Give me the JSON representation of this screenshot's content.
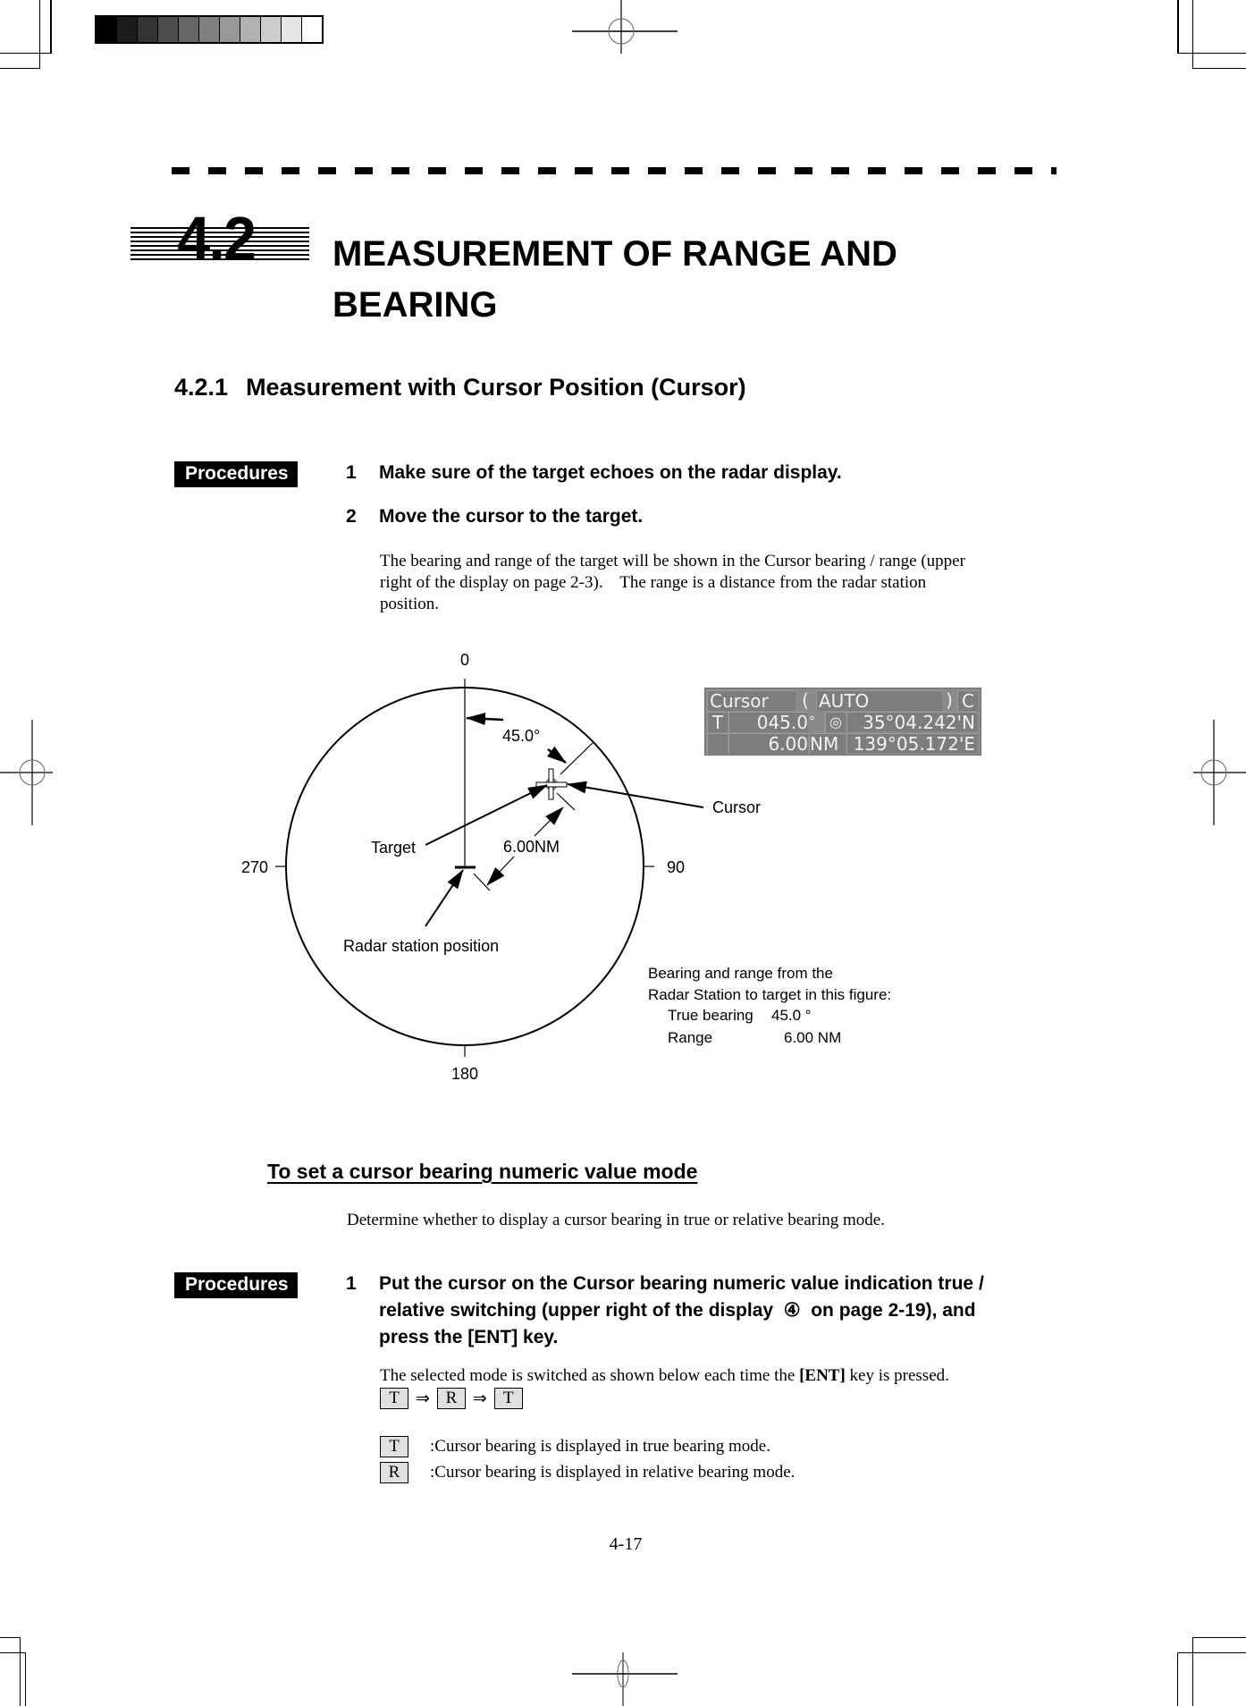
{
  "print_marks": {
    "grayscale_steps": [
      "#000000",
      "#1c1c1c",
      "#333333",
      "#4d4d4d",
      "#676767",
      "#808080",
      "#989898",
      "#b2b2b2",
      "#cccccc",
      "#e6e6e6",
      "#ffffff"
    ]
  },
  "header": {
    "section_number": "4.2",
    "section_title_line1": "MEASUREMENT OF RANGE AND",
    "section_title_line2": "BEARING"
  },
  "subsection": {
    "number": "4.2.1",
    "title": "Measurement with Cursor Position (Cursor)"
  },
  "procedure1": {
    "badge": "Procedures",
    "steps": [
      {
        "num": "1",
        "text": "Make sure of the target echoes on the radar display."
      },
      {
        "num": "2",
        "text": "Move the cursor to the target."
      }
    ],
    "note_line1": "The bearing and range of the target will be shown in the Cursor bearing / range (upper",
    "note_line2": "right of the display on page 2-3).    The range is a distance from the radar station",
    "note_line3": "position."
  },
  "figure": {
    "label_0": "0",
    "label_90": "90",
    "label_180": "180",
    "label_270": "270",
    "angle_label": "45.0°",
    "range_label": "6.00NM",
    "target_label": "Target",
    "cursor_label": "Cursor",
    "radar_label": "Radar station position",
    "caption_line1": "Bearing and range from the",
    "caption_line2": "Radar Station to target in this figure:",
    "caption_bearing_label": "True bearing",
    "caption_bearing_value": "45.0 °",
    "caption_range_label": "Range",
    "caption_range_value": "6.00 NM",
    "bearing_deg": 45.0,
    "range_nm": 6.0
  },
  "cursor_panel": {
    "title": "Cursor",
    "paren_open": "(",
    "mode": "AUTO",
    "paren_close": ")",
    "c_label": "C",
    "bearing_mode": "T",
    "bearing_value": "045.0",
    "bearing_unit": "°",
    "latitude": "35°04.242'N",
    "range_value": "6.00",
    "range_unit": "NM",
    "longitude": "139°05.172'E",
    "target_icon": "◎"
  },
  "mode_section": {
    "heading": "To set a cursor bearing numeric value mode",
    "description": "Determine whether to display a cursor bearing in true or relative bearing mode."
  },
  "procedure2": {
    "badge": "Procedures",
    "step_num": "1",
    "step_line1": "Put the cursor on the Cursor bearing numeric value indication true /",
    "step_line2": "relative switching (upper right of the display  ④  on page 2-19), and",
    "step_line3": "press the [ENT] key.",
    "note_prefix": "The selected mode is switched as shown below each time the ",
    "note_key": "[ENT]",
    "note_suffix": " key is pressed.",
    "sequence": [
      "T",
      "R",
      "T"
    ],
    "sequence_arrow": "⇒",
    "legend": [
      {
        "key": "T",
        "text": ":Cursor bearing is displayed in true bearing mode."
      },
      {
        "key": "R",
        "text": ":Cursor bearing is displayed in relative bearing mode."
      }
    ]
  },
  "footer": {
    "page_number": "4-17"
  }
}
